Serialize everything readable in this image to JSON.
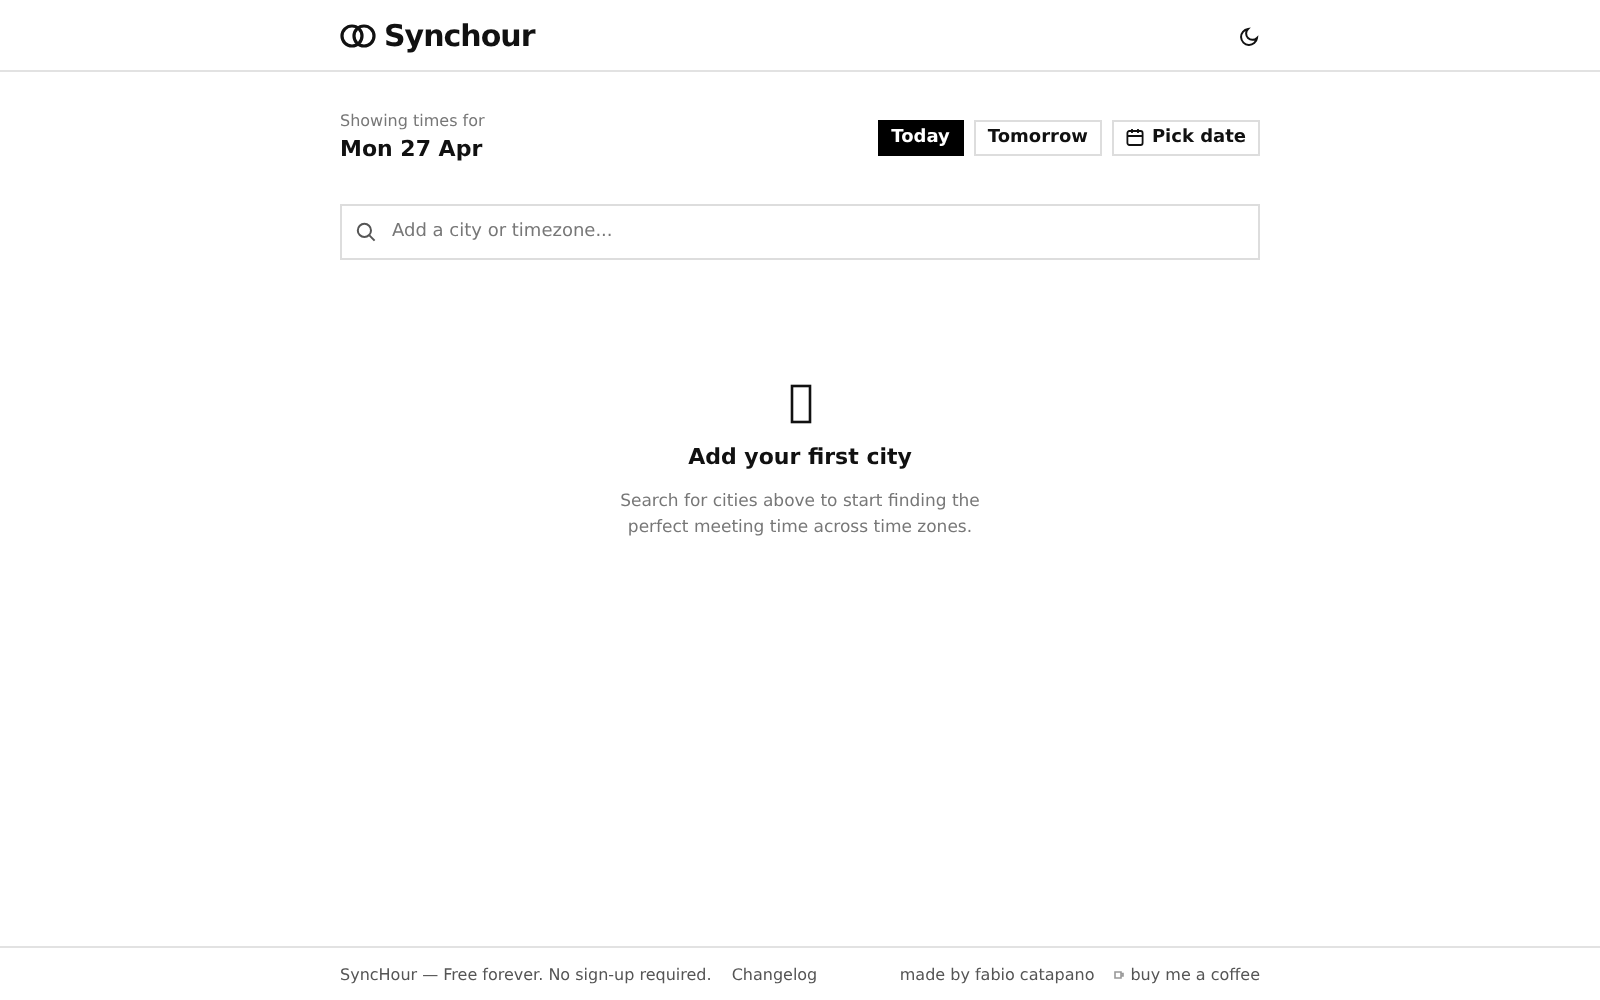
{
  "header": {
    "brand": "Synchour"
  },
  "date_bar": {
    "caption": "Showing times for",
    "date": "Mon 27 Apr",
    "buttons": [
      {
        "label": "Today",
        "selected": true,
        "kind": "plain"
      },
      {
        "label": "Tomorrow",
        "selected": false,
        "kind": "plain"
      },
      {
        "label": "Pick date",
        "selected": false,
        "kind": "calendar"
      }
    ]
  },
  "search": {
    "placeholder": "Add a city or timezone..."
  },
  "empty_state": {
    "title": "Add your first city",
    "text": "Search for cities above to start finding the perfect meeting time across time zones."
  },
  "footer": {
    "tagline": "SyncHour — Free forever. No sign-up required.",
    "changelog": "Changelog",
    "credit": "made by fabio catapano",
    "coffee": "buy me a coffee"
  }
}
